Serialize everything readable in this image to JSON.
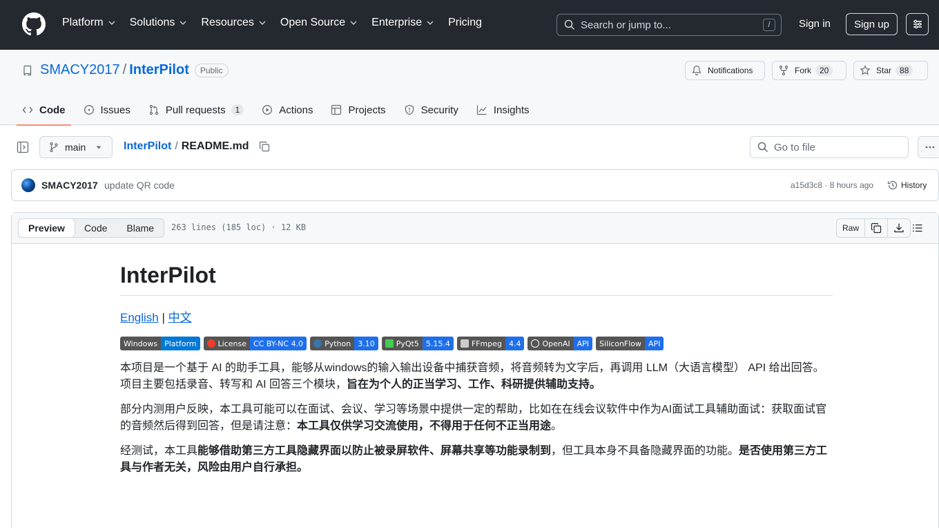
{
  "header": {
    "nav": [
      "Platform",
      "Solutions",
      "Resources",
      "Open Source",
      "Enterprise",
      "Pricing"
    ],
    "nav_has_dropdown": [
      true,
      true,
      true,
      true,
      true,
      false
    ],
    "search_placeholder": "Search or jump to...",
    "search_shortcut": "/",
    "sign_in": "Sign in",
    "sign_up": "Sign up"
  },
  "repo": {
    "owner": "SMACY2017",
    "separator": "/",
    "name": "InterPilot",
    "visibility": "Public",
    "notifications_label": "Notifications",
    "fork_label": "Fork",
    "fork_count": "20",
    "star_label": "Star",
    "star_count": "88"
  },
  "tabs": [
    {
      "label": "Code",
      "icon": "code-icon",
      "active": true
    },
    {
      "label": "Issues",
      "icon": "issue-icon"
    },
    {
      "label": "Pull requests",
      "icon": "pull-request-icon",
      "count": "1"
    },
    {
      "label": "Actions",
      "icon": "play-icon"
    },
    {
      "label": "Projects",
      "icon": "table-icon"
    },
    {
      "label": "Security",
      "icon": "shield-icon"
    },
    {
      "label": "Insights",
      "icon": "graph-icon"
    }
  ],
  "file_nav": {
    "branch": "main",
    "crumb_repo": "InterPilot",
    "crumb_sep": "/",
    "crumb_file": "README.md",
    "goto_placeholder": "Go to file"
  },
  "commit": {
    "author": "SMACY2017",
    "message": "update QR code",
    "sha_time": "a15d3c8 · 8 hours ago",
    "history": "History"
  },
  "file": {
    "views": [
      "Preview",
      "Code",
      "Blame"
    ],
    "info": "263 lines (185 loc) · 12 KB",
    "raw": "Raw"
  },
  "readme": {
    "title": "InterPilot",
    "lang_en": "English",
    "lang_sep": " | ",
    "lang_zh": "中文",
    "badges": [
      {
        "left": "Windows",
        "right": "Platform",
        "color": "#0078d6",
        "icon": ""
      },
      {
        "left": "License",
        "right": "CC BY-NC 4.0",
        "color": "#1f6feb",
        "icon": "cc-icon"
      },
      {
        "left": "Python",
        "right": "3.10",
        "color": "#1f6feb",
        "icon": "python-icon"
      },
      {
        "left": "PyQt5",
        "right": "5.15.4",
        "color": "#1f6feb",
        "icon": "qt-icon"
      },
      {
        "left": "FFmpeg",
        "right": "4.4",
        "color": "#1f6feb",
        "icon": "ffmpeg-icon"
      },
      {
        "left": "OpenAI",
        "right": "API",
        "color": "#1f6feb",
        "icon": "openai-icon"
      },
      {
        "left": "SiliconFlow",
        "right": "API",
        "color": "#1f6feb",
        "icon": ""
      }
    ],
    "p1_plain": "本项目是一个基于 AI 的助手工具，能够从windows的输入输出设备中捕获音频，将音频转为文字后，再调用 LLM（大语言模型） API 给出回答。项目主要包括录音、转写和 AI 回答三个模块，",
    "p1_bold": "旨在为个人的正当学习、工作、科研提供辅助支持。",
    "p2_plain": "部分内测用户反映，本工具可能可以在面试、会议、学习等场景中提供一定的帮助，比如在在线会议软件中作为AI面试工具辅助面试：获取面试官的音频然后得到回答，但是请注意：",
    "p2_bold": "本工具仅供学习交流使用，不得用于任何不正当用途",
    "p2_end": "。",
    "p3_a": "经测试，本工具",
    "p3_b": "能够借助第三方工具隐藏界面以防止被录屏软件、屏幕共享等功能录制到",
    "p3_c": "，但工具本身不具备隐藏界面的功能。",
    "p3_d": "是否使用第三方工具与作者无关，风险由用户自行承担。"
  }
}
